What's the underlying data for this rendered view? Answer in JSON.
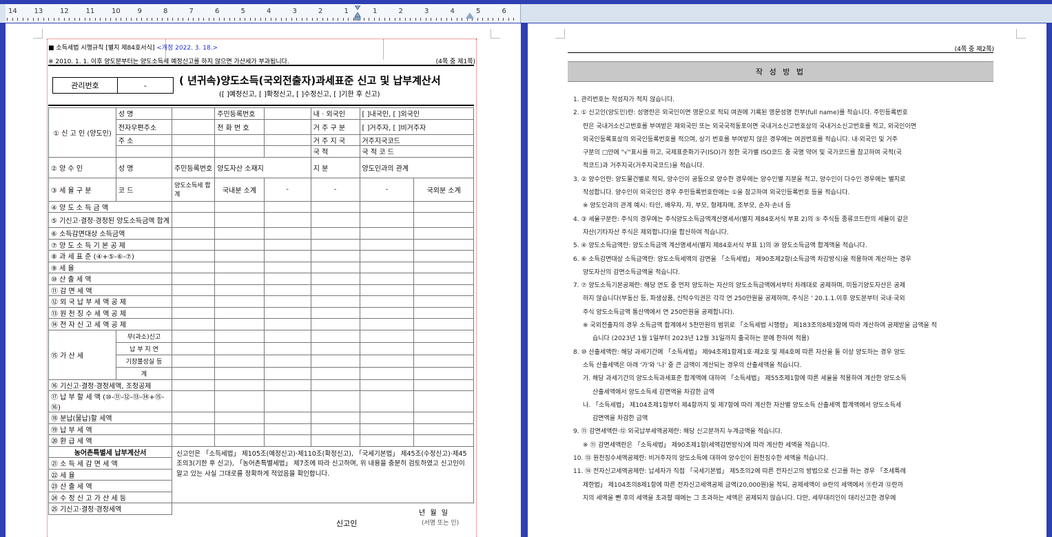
{
  "ruler": {
    "numbers": [
      "14",
      "13",
      "12",
      "11",
      "10",
      "9",
      "8",
      "7",
      "6",
      "5",
      "4",
      "3",
      "2",
      "1",
      "1",
      "2",
      "3",
      "4",
      "5",
      "6"
    ]
  },
  "left_page": {
    "header_line": "■ 소득세법 시행규칙 [별지 제84호서식]",
    "header_revision": "<개정 2022. 3. 18.>",
    "notice": "※ 2010. 1. 1. 이후 양도분부터는 양도소득세 예정신고를 하지 않으면 가산세가 부과됩니다.",
    "page_mark": "(4쪽 중 제1쪽)",
    "mgmt_label": "관리번호",
    "mgmt_value": "-",
    "title": "(    년귀속)양도소득(국외전출자)과세표준 신고 및 납부계산서",
    "subtitle": "([  ]예정신고, [  ]확정신고, [  ]수정신고, [  ]기한 후 신고)",
    "section1": {
      "label": "① 신 고 인 (양도인)",
      "rows": [
        [
          "성      명",
          "",
          "주민등록번호",
          "",
          "내 · 외국인",
          "[  ]내국인,  [  ]외국인"
        ],
        [
          "전자우편주소",
          "",
          "전 화 번 호",
          "",
          "거 주 구 분",
          "[  ]거주자,  [  ]비거주자"
        ],
        [
          "주      소",
          "",
          "",
          "",
          "거 주 지 국",
          "거주지국코드"
        ],
        [
          "",
          "",
          "",
          "",
          "국      적",
          "국 적 코 드"
        ]
      ]
    },
    "section2": {
      "label": "② 양 수 인",
      "cols": [
        "성      명",
        "주민등록번호",
        "양도자산 소재지",
        "지      분",
        "양도인과의 관계"
      ]
    },
    "section3": {
      "label": "③ 세 율 구 분",
      "cols": [
        "코      드",
        "양도소득세 합 계",
        "국내분 소계",
        "-",
        "-",
        "-",
        "국외분 소계"
      ]
    },
    "items": [
      "④ 양 도 소 득 금 액",
      "⑤ 기신고·결정·경정된 양도소득금액 합계",
      "⑥ 소득감면대상 소득금액",
      "⑦ 양 도 소 득 기 본 공 제",
      "⑧ 과 세 표 준 (④+⑤-⑥-⑦)",
      "⑨ 세                율",
      "⑩ 산 출 세 액",
      "⑪ 감 면 세 액",
      "⑫ 외 국 납 부 세 액 공 제",
      "⑬ 원 천 징 수 세 액 공 제",
      "⑭ 전 자 신 고 세 액 공 제"
    ],
    "penalty": {
      "label": "⑮ 가 산 세",
      "sub": [
        "무(과소)신고",
        "납 부 지 연",
        "기장불성실 등",
        "계"
      ]
    },
    "items2": [
      "⑯ 기신고·결정·경정세액, 조정공제",
      "⑰ 납 부 할 세 액 (⑩-⑪-⑫-⑬-⑭+⑮-⑯)",
      "⑱ 분납(물납)할 세액",
      "⑲ 납 부 세 액",
      "⑳ 환 급 세 액"
    ],
    "farm_tax": {
      "title": "농어촌특별세 납부계산서",
      "items": [
        "㉑ 소 득 세 감 면 세 액",
        "㉒ 세                율",
        "㉓ 산 출 세 액",
        "㉔ 수 정 신 고 가 산 세 등",
        "㉕ 기신고·결정·경정세액"
      ]
    },
    "declaration": "신고인은 「소득세법」 제105조(예정신고)·제110조(확정신고), 「국세기본법」 제45조(수정신고)·제45조의3(기한 후 신고), 「농어촌특별세법」 제7조에 따라 신고하며, 위 내용을 충분히 검토하였고 신고인이 알고 있는 사실 그대로를 정확하게 적었음을 확인합니다.",
    "date_line": "년      월      일",
    "signer": "신고인",
    "sign_note": "(서명 또는 인)"
  },
  "right_page": {
    "page_mark": "(4쪽 중 제2쪽)",
    "band_title": "작 성 방 법",
    "instructions": [
      {
        "lvl": 0,
        "t": "1. 관리번호는 작성자가 적지 않습니다."
      },
      {
        "lvl": 0,
        "t": "2. ① 신고인(양도인)란: 성명란은 외국인이면 영문으로 적되 여권에 기록된 영문성명 전부(full name)를 적습니다. 주민등록번호"
      },
      {
        "lvl": 1,
        "t": "란은 국내거소신고번호를 부여받은 재외국민 또는 외국국적동포이면 국내거소신고번호상의 국내거소신고번호를 적고, 외국인이면"
      },
      {
        "lvl": 1,
        "t": "외국인등록표상의 외국인등록번호를 적으며, 상기 번호를 부여받지 않은 경우에는 여권번호를 적습니다. 내·외국인 및 거주"
      },
      {
        "lvl": 1,
        "t": "구분의 □안에 \"√\"표시를 하고, 국제표준화기구(ISO)가 정한 국가별 ISO코드 중 국명 약어 및 국가코드를 참고하여 국적(국"
      },
      {
        "lvl": 1,
        "t": "적코드)과 거주지국(거주지국코드)을 적습니다."
      },
      {
        "lvl": 0,
        "t": "3. ② 양수인란: 양도물건별로 적되, 양수인이 공동으로 양수한 경우에는 양수인별 지분을 적고, 양수인이 다수인 경우에는 별지로"
      },
      {
        "lvl": 1,
        "t": "작성합니다. 양수인이 외국인인 경우 주민등록번호란에는 ①을 참고하여 외국인등록번호 등을 적습니다."
      },
      {
        "lvl": 1,
        "t": "※ 양도인과의 관계 예시: 타인, 배우자, 자, 부모, 형제자매, 조부모, 손자·손녀 등"
      },
      {
        "lvl": 0,
        "t": "4. ③ 세율구분란: 주식의 경우에는 주식양도소득금액계산명세서(별지 제84호서식 부표 2)의 ⑤ 주식등 종류코드란의 세율이 같은"
      },
      {
        "lvl": 1,
        "t": "자산(기타자산 주식은 제외합니다)을 합산하여 적습니다."
      },
      {
        "lvl": 0,
        "t": "5. ④ 양도소득금액란: 양도소득금액 계산명세서(별지 제84호서식 부표 1)의 ⑳ 양도소득금액 합계액을 적습니다."
      },
      {
        "lvl": 0,
        "t": "6. ⑥ 소득감면대상 소득금액란: 양도소득세액의 감면을 「소득세법」 제90조제2항(소득금액 차감방식)을 적용하여 계산하는 경우"
      },
      {
        "lvl": 1,
        "t": "양도자산의 감면소득금액을 적습니다."
      },
      {
        "lvl": 0,
        "t": "7. ⑦ 양도소득기본공제란: 해당 연도 중 먼저 양도하는 자산의 양도소득금액에서부터 차례대로 공제하며, 미등기양도자산은 공제"
      },
      {
        "lvl": 1,
        "t": "하지 않습니다(부동산 등, 파생상품, 신탁수익권은 각각 연 250만원을 공제하며, 주식은 ' 20.1.1.이후 양도분부터 국내·국외"
      },
      {
        "lvl": 1,
        "t": "주식 양도소득금액 통산액에서 연 250만원을 공제합니다)."
      },
      {
        "lvl": 1,
        "t": "※ 국외전출자의 경우 소득금액 합계에서 5천만원의 범위로 「소득세법 시행령」 제183조의8제3항에 따라 계산하여 공제받을 금액을 적"
      },
      {
        "lvl": 2,
        "t": "습니다 (2023년 1월 1일부터 2023년 12월 31일까지 출국하는 분에 한하여 적용)"
      },
      {
        "lvl": 0,
        "t": "8. ⑩ 산출세액란: 해당 과세기간에 「소득세법」 제94조제1항제1호·제2호 및 제4호에 따른 자산을 둘 이상 양도하는 경우 양도"
      },
      {
        "lvl": 1,
        "t": "소득 산출세액은 아래 '가'와 '나' 중 큰 금액이 계산되는 경우의 산출세액을 적습니다."
      },
      {
        "lvl": 1,
        "t": "가. 해당 과세기간의 양도소득과세표준 합계액에 대하여 「소득세법」 제55조제1항에 따른 세율을 적용하여 계산한 양도소득"
      },
      {
        "lvl": 2,
        "t": "산출세액에서 양도소득세 감면액을 차감한 금액"
      },
      {
        "lvl": 1,
        "t": "나. 「소득세법」 제104조제1항부터 제4항까지 및 제7항에 따라 계산한 자산별 양도소득 산출세액 합계액에서 양도소득세"
      },
      {
        "lvl": 2,
        "t": "감면액을 차감한 금액"
      },
      {
        "lvl": 0,
        "t": "9. ⑪ 감면세액란·⑫ 외국납부세액공제란: 해당 신고분까지 누계금액을 적습니다."
      },
      {
        "lvl": 1,
        "t": "※ ⑪ 감면세액란은 「소득세법」 제90조제1항(세액감면방식)에 따라 계산한 세액을 적습니다."
      },
      {
        "lvl": 0,
        "t": "10. ⑬ 원천징수세액공제란: 비거주자의 양도소득에 대하여 양수인이 원천징수한 세액을 적습니다."
      },
      {
        "lvl": 0,
        "t": "11. ⑭ 전자신고세액공제란: 납세자가 직접 「국세기본법」 제5조의2에 따른 전자신고의 방법으로 신고를 하는 경우 「조세특례"
      },
      {
        "lvl": 1,
        "t": "제한법」 제104조의8제1항에 따른 전자신고세액공제 금액(20,000원)을 적되, 공제세액이 ⑩란의 세액에서 ⑪란과 ⑫란까"
      },
      {
        "lvl": 1,
        "t": "지의 세액을 뺀 후의 세액을 초과할 때에는 그 초과하는 세액은 공제되지 않습니다. 다만, 세무대리인이 대리신고한 경우에"
      }
    ]
  }
}
